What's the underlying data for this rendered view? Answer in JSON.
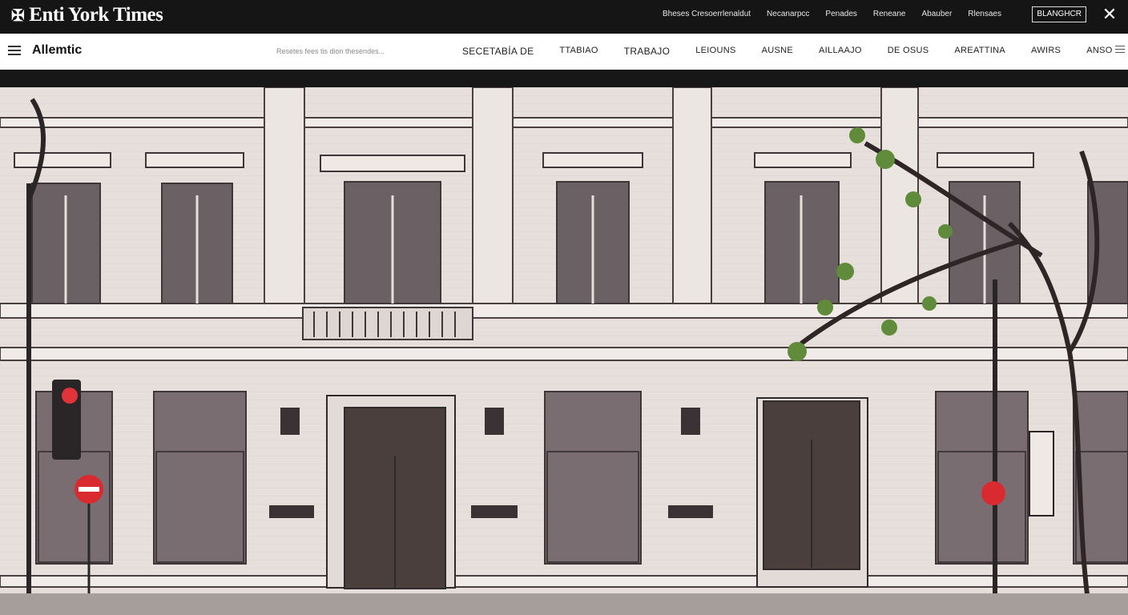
{
  "header": {
    "logo_text": "Enti York Times",
    "links": [
      "Bheses Cresoerrlenaldut",
      "Necanarpcc",
      "Penades",
      "Reneane",
      "Abauber",
      "Rlensaes"
    ],
    "button_label": "BLANGHCR",
    "close_icon": "close-icon"
  },
  "nav": {
    "brand": "Allemtic",
    "search_placeholder": "Resetes  fees tis dion thesendes...",
    "items": [
      "SECETABÍA DE",
      "TTABIAO",
      "TRABAJO",
      "LEIOUNS",
      "AUSNE",
      "AILLAAJO",
      "DE OSUS",
      "AREATTINA",
      "AWIRS",
      "ANSO"
    ]
  },
  "hero": {
    "image_description_icon": "building-facade-illustration"
  },
  "colors": {
    "top_bar": "#151515",
    "nav_bg": "#ffffff",
    "facade": "#e6dfdb",
    "window": "#5a4f54",
    "door": "#4b3f3d"
  }
}
